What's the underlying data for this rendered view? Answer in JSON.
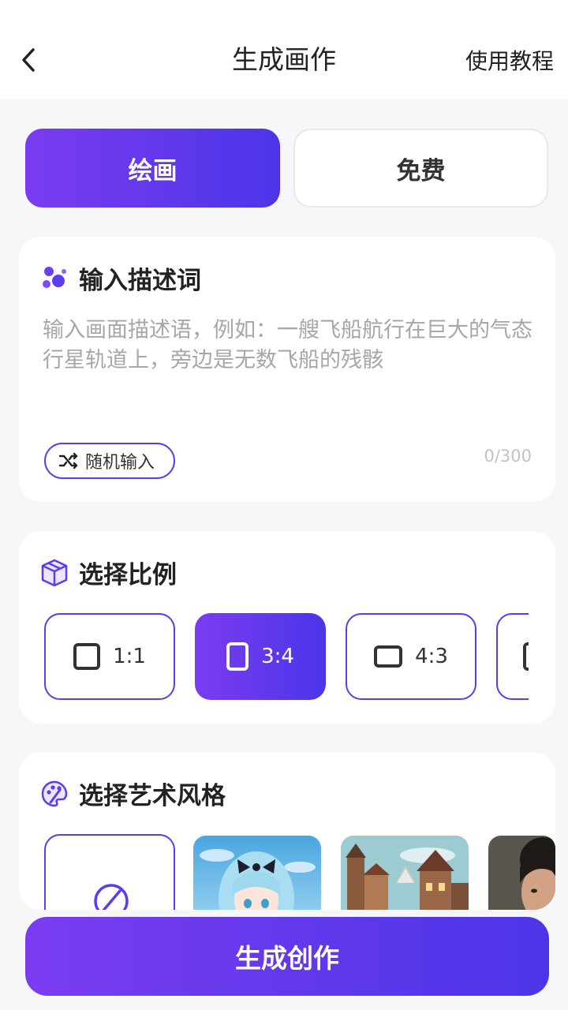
{
  "header": {
    "title": "生成画作",
    "help_link": "使用教程",
    "back_icon": "chevron-left-icon"
  },
  "tabs": [
    {
      "label": "绘画",
      "active": true
    },
    {
      "label": "免费",
      "active": false
    }
  ],
  "prompt_card": {
    "title": "输入描述词",
    "icon": "bubbles-icon",
    "placeholder": "输入画面描述语，例如：一艘飞船航行在巨大的气态行星轨道上，旁边是无数飞船的残骸",
    "random_button": "随机输入",
    "random_icon": "shuffle-icon",
    "char_count": "0/300"
  },
  "ratio_card": {
    "title": "选择比例",
    "icon": "cube-icon",
    "options": [
      {
        "label": "1:1",
        "selected": false
      },
      {
        "label": "3:4",
        "selected": true
      },
      {
        "label": "4:3",
        "selected": false
      },
      {
        "label": "",
        "selected": false
      }
    ]
  },
  "style_card": {
    "title": "选择艺术风格",
    "icon": "palette-icon",
    "none_icon": "no-style-icon",
    "thumbnails": [
      "anime-girl-thumbnail",
      "fantasy-town-thumbnail",
      "portrait-thumbnail"
    ]
  },
  "generate_button": "生成创作",
  "colors": {
    "accent_start": "#7b3cf0",
    "accent_end": "#4c35e8",
    "background": "#f6f7f9"
  }
}
